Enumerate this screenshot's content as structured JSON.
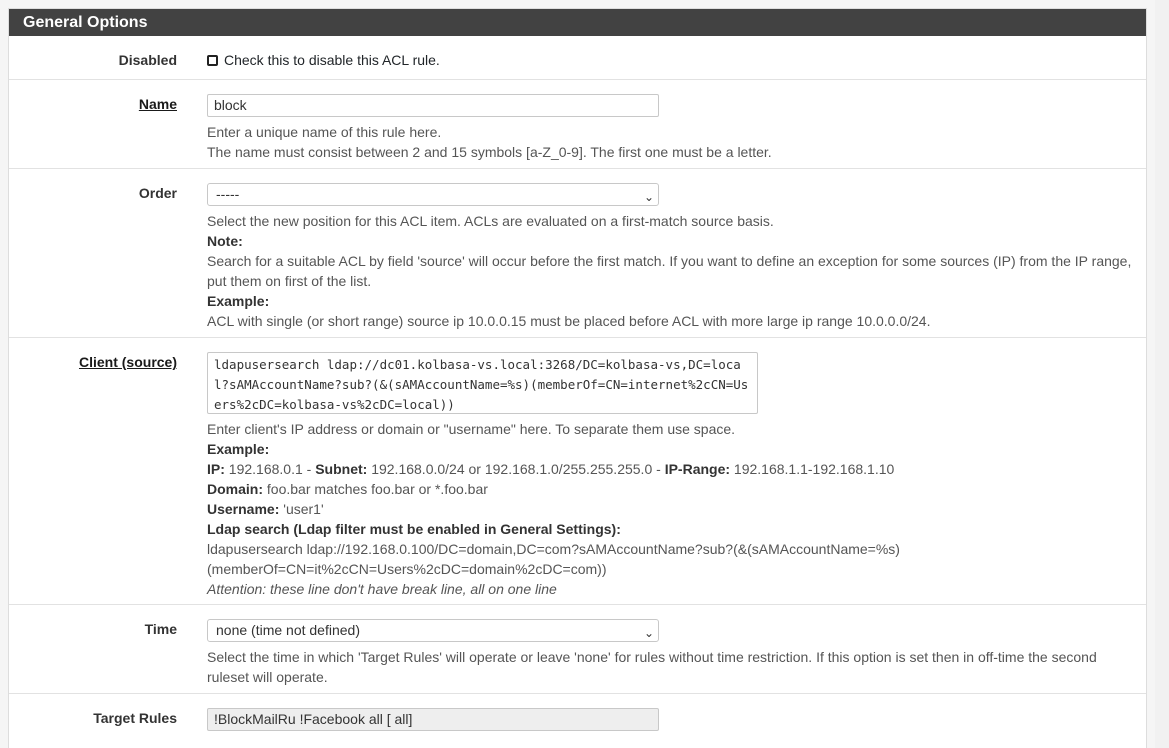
{
  "panel": {
    "title": "General Options"
  },
  "disabled": {
    "label": "Disabled",
    "checkbox_text": "Check this to disable this ACL rule."
  },
  "name": {
    "label": "Name",
    "value": "block",
    "help_line1": "Enter a unique name of this rule here.",
    "help_line2": "The name must consist between 2 and 15 symbols [a-Z_0-9]. The first one must be a letter."
  },
  "order": {
    "label": "Order",
    "selected": "-----",
    "help_line1": "Select the new position for this ACL item. ACLs are evaluated on a first-match source basis.",
    "note_label": "Note:",
    "note_text": "Search for a suitable ACL by field 'source' will occur before the first match. If you want to define an exception for some sources (IP) from the IP range, put them on first of the list.",
    "example_label": "Example:",
    "example_text": "ACL with single (or short range) source ip 10.0.0.15 must be placed before ACL with more large ip range 10.0.0.0/24."
  },
  "client": {
    "label": "Client (source)",
    "value": "ldapusersearch ldap://dc01.kolbasa-vs.local:3268/DC=kolbasa-vs,DC=local?sAMAccountName?sub?(&(sAMAccountName=%s)(memberOf=CN=internet%2cCN=Users%2cDC=kolbasa-vs%2cDC=local))",
    "help_line1": "Enter client's IP address or domain or \"username\" here. To separate them use space.",
    "example_label": "Example:",
    "ip_label": "IP:",
    "ip_value": "192.168.0.1",
    "sep1": " - ",
    "subnet_label": "Subnet:",
    "subnet_value": "192.168.0.0/24 or 192.168.1.0/255.255.255.0",
    "sep2": " - ",
    "range_label": "IP-Range:",
    "range_value": "192.168.1.1-192.168.1.10",
    "domain_label": "Domain:",
    "domain_value": "foo.bar matches foo.bar or *.foo.bar",
    "username_label": "Username:",
    "username_value": "'user1'",
    "ldap_label": "Ldap search (Ldap filter must be enabled in General Settings):",
    "ldap_line1": "ldapusersearch ldap://192.168.0.100/DC=domain,DC=com?sAMAccountName?sub?(&(sAMAccountName=%s)",
    "ldap_line2": "(memberOf=CN=it%2cCN=Users%2cDC=domain%2cDC=com))",
    "attention": "Attention: these line don't have break line, all on one line"
  },
  "time": {
    "label": "Time",
    "selected": "none (time not defined)",
    "help_text": "Select the time in which 'Target Rules' will operate or leave 'none' for rules without time restriction. If this option is set then in off-time the second ruleset will operate."
  },
  "target": {
    "label": "Target Rules",
    "value": "!BlockMailRu !Facebook all [ all]"
  }
}
